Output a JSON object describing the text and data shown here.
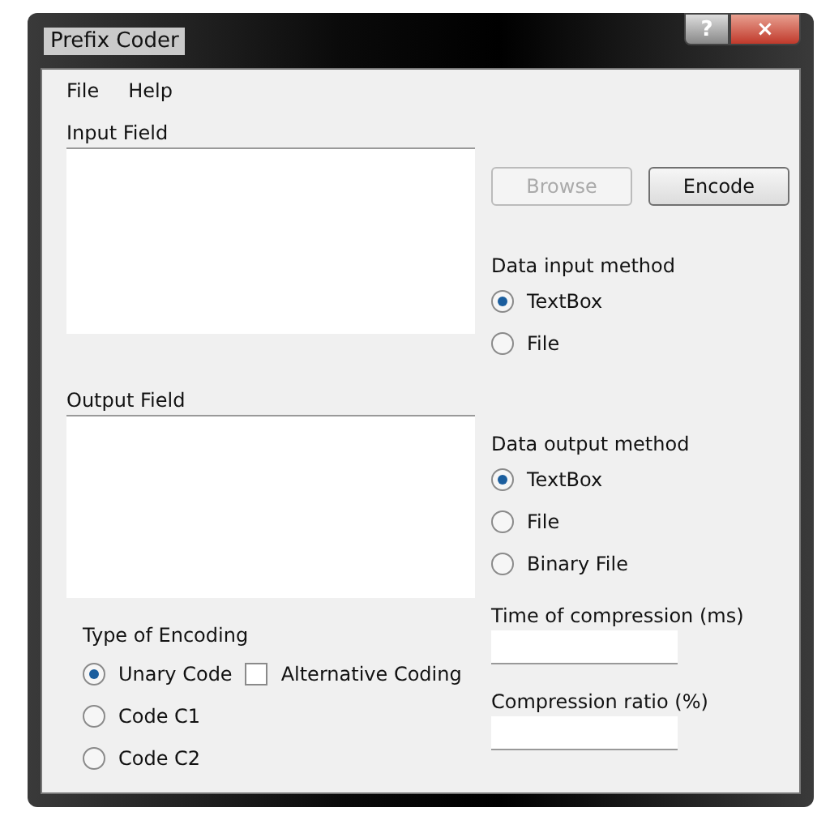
{
  "window": {
    "title": "Prefix Coder",
    "controls": [
      {
        "kind": "help",
        "label": "?"
      },
      {
        "kind": "close",
        "label": "×"
      }
    ]
  },
  "menu": [
    "File",
    "Help"
  ],
  "input_field": {
    "label": "Input Field"
  },
  "buttons": [
    {
      "label": "Browse",
      "disabled": true
    },
    {
      "label": "Encode",
      "disabled": false
    }
  ],
  "data_input_method": {
    "label": "Data input method",
    "options": [
      {
        "label": "TextBox",
        "selected": true
      },
      {
        "label": "File",
        "selected": false
      }
    ]
  },
  "output_field": {
    "label": "Output Field"
  },
  "data_output_method": {
    "label": "Data output method",
    "options": [
      {
        "label": "TextBox",
        "selected": true
      },
      {
        "label": "File",
        "selected": false
      },
      {
        "label": "Binary File",
        "selected": false
      }
    ]
  },
  "type_of_encoding": {
    "label": "Type of Encoding",
    "options": [
      {
        "label": "Unary Code",
        "selected": true
      },
      {
        "label": "Code C1",
        "selected": false
      },
      {
        "label": "Code C2",
        "selected": false
      }
    ],
    "alternative": {
      "label": "Alternative Coding",
      "checked": false
    }
  },
  "time_of_compression": {
    "label": "Time of compression (ms)"
  },
  "compression_ratio": {
    "label": "Compression ratio (%)"
  }
}
